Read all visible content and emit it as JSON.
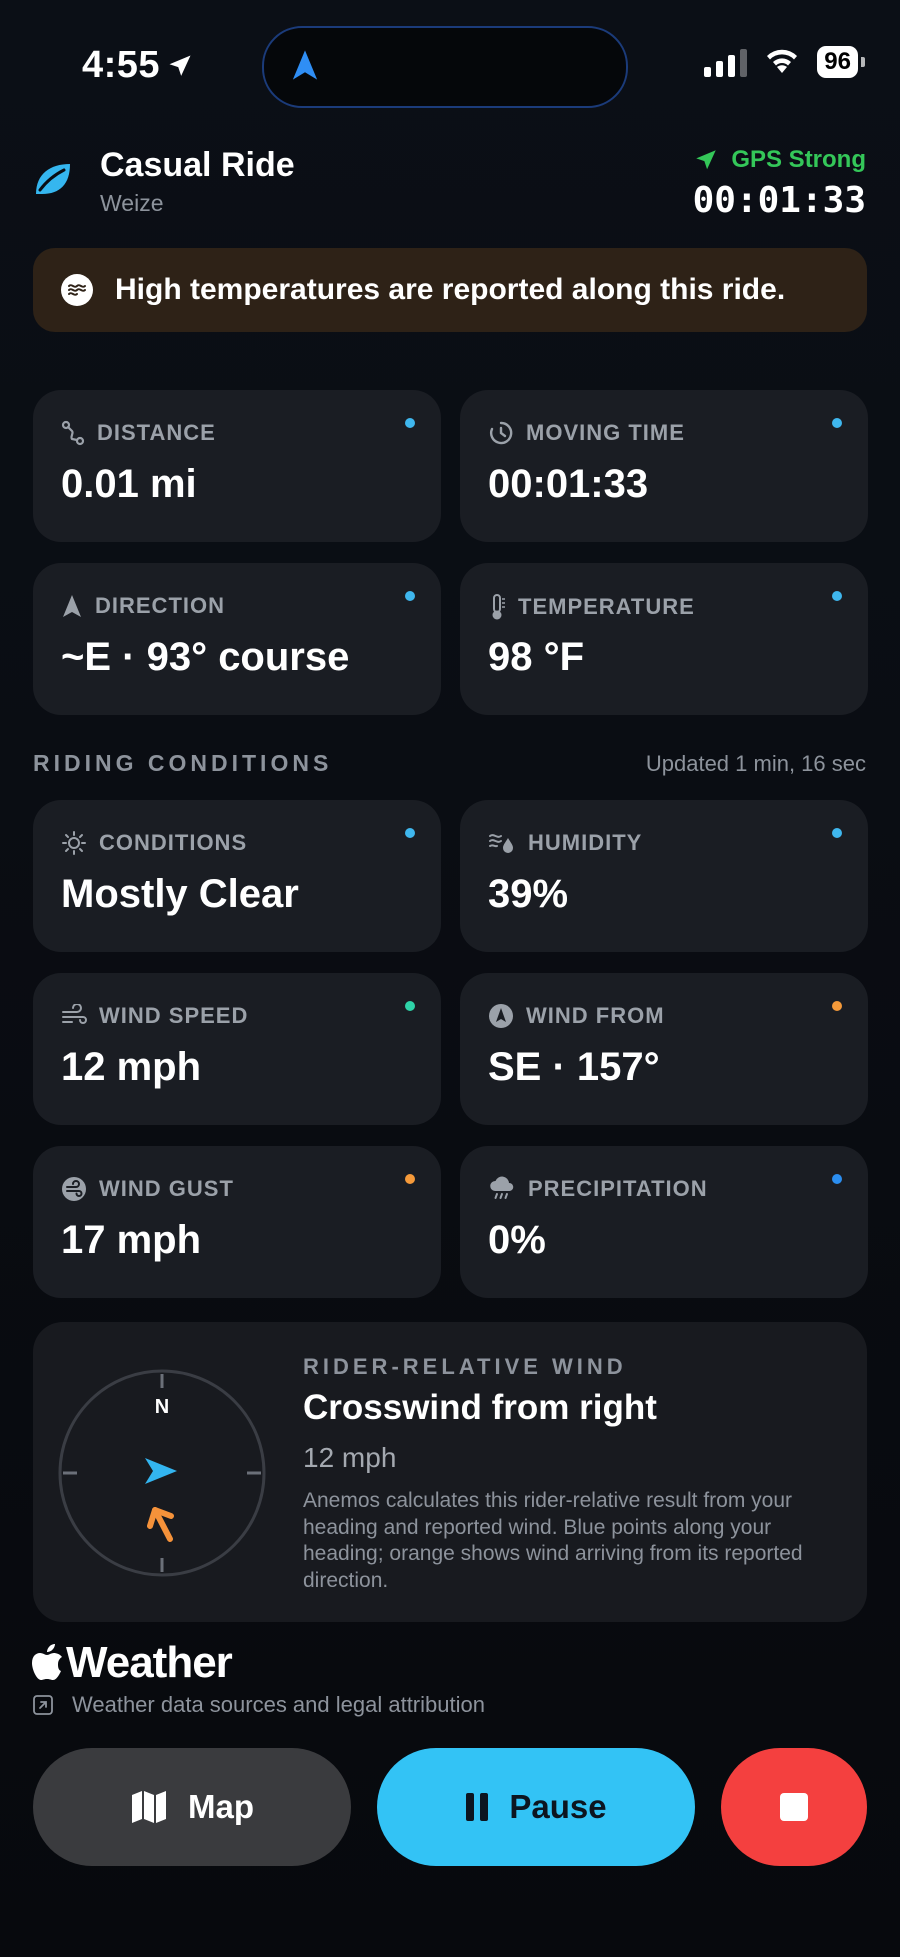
{
  "status_bar": {
    "time": "4:55",
    "battery": "96"
  },
  "header": {
    "title": "Casual Ride",
    "subtitle": "Weize",
    "gps_status": "GPS Strong",
    "elapsed": "00:01:33"
  },
  "alert": {
    "text": "High temperatures are reported along this ride."
  },
  "stats": [
    {
      "label": "DISTANCE",
      "value": "0.01 mi",
      "dot_color": "#3fb7ee"
    },
    {
      "label": "MOVING TIME",
      "value": "00:01:33",
      "dot_color": "#3fb7ee"
    },
    {
      "label": "DIRECTION",
      "value": "~E · 93° course",
      "dot_color": "#3fb7ee"
    },
    {
      "label": "TEMPERATURE",
      "value": "98 °F",
      "dot_color": "#3fb7ee"
    }
  ],
  "conditions_section": {
    "title": "RIDING CONDITIONS",
    "updated": "Updated 1 min, 16 sec"
  },
  "conditions": [
    {
      "label": "CONDITIONS",
      "value": "Mostly Clear",
      "dot_color": "#3fb7ee"
    },
    {
      "label": "HUMIDITY",
      "value": "39%",
      "dot_color": "#3fb7ee"
    },
    {
      "label": "WIND SPEED",
      "value": "12 mph",
      "dot_color": "#2ed3a8"
    },
    {
      "label": "WIND FROM",
      "value": "SE · 157°",
      "dot_color": "#f59a3a"
    },
    {
      "label": "WIND GUST",
      "value": "17 mph",
      "dot_color": "#f59a3a"
    },
    {
      "label": "PRECIPITATION",
      "value": "0%",
      "dot_color": "#2b8ef0"
    }
  ],
  "wind_panel": {
    "label": "RIDER-RELATIVE WIND",
    "result": "Crosswind from right",
    "speed": "12 mph",
    "compass_north": "N",
    "description": "Anemos calculates this rider-relative result from your heading and reported wind. Blue points along your heading; orange shows wind arriving from its reported direction."
  },
  "attribution": {
    "logo_text": "Weather",
    "link_text": "Weather data sources and legal attribution"
  },
  "controls": {
    "map_label": "Map",
    "pause_label": "Pause"
  },
  "colors": {
    "accent": "#33c3f5",
    "gps_green": "#34c759",
    "stop_red": "#f4403f",
    "wind_orange": "#f5923a",
    "heading_blue": "#33b5f0"
  }
}
